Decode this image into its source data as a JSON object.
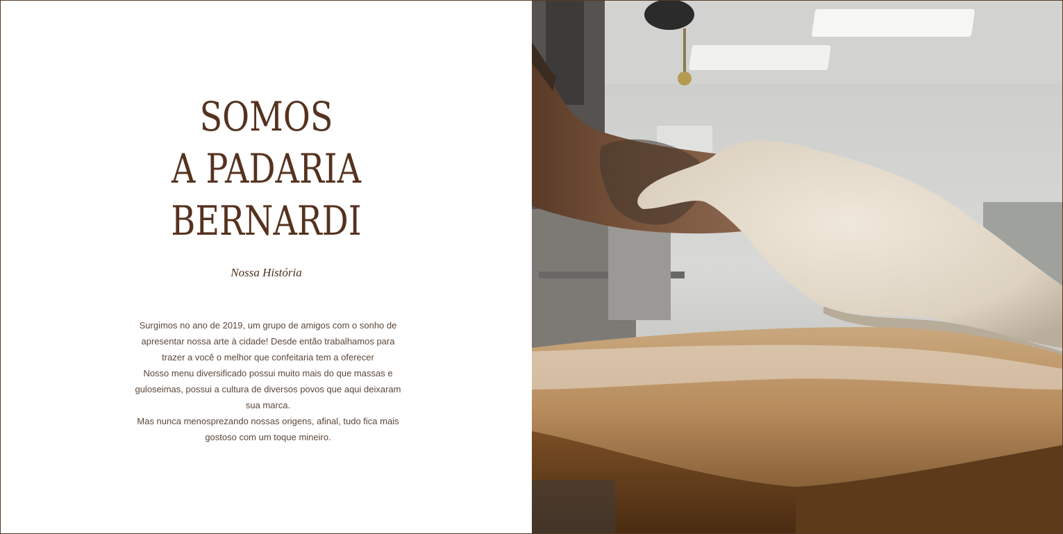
{
  "about": {
    "title_lines": [
      "SOMOS",
      "A PADARIA",
      "BERNARDI"
    ],
    "subtitle": "Nossa História",
    "paragraphs": [
      "Surgimos no ano de 2019, um grupo de amigos com o sonho de apresentar nossa arte à cidade! Desde então trabalhamos para trazer a você o melhor que confeitaria tem a oferecer",
      "Nosso menu diversificado possui muito mais do que massas e guloseimas, possui a cultura de diversos povos que aqui deixaram sua marca.",
      "Mas nunca menosprezando nossas origens, afinal, tudo fica mais gostoso com um toque mineiro."
    ]
  },
  "image": {
    "semantic": "baker-stretching-dough-photo"
  },
  "colors": {
    "title": "#55321f",
    "text": "#5b463a",
    "border": "#5a3a24"
  }
}
